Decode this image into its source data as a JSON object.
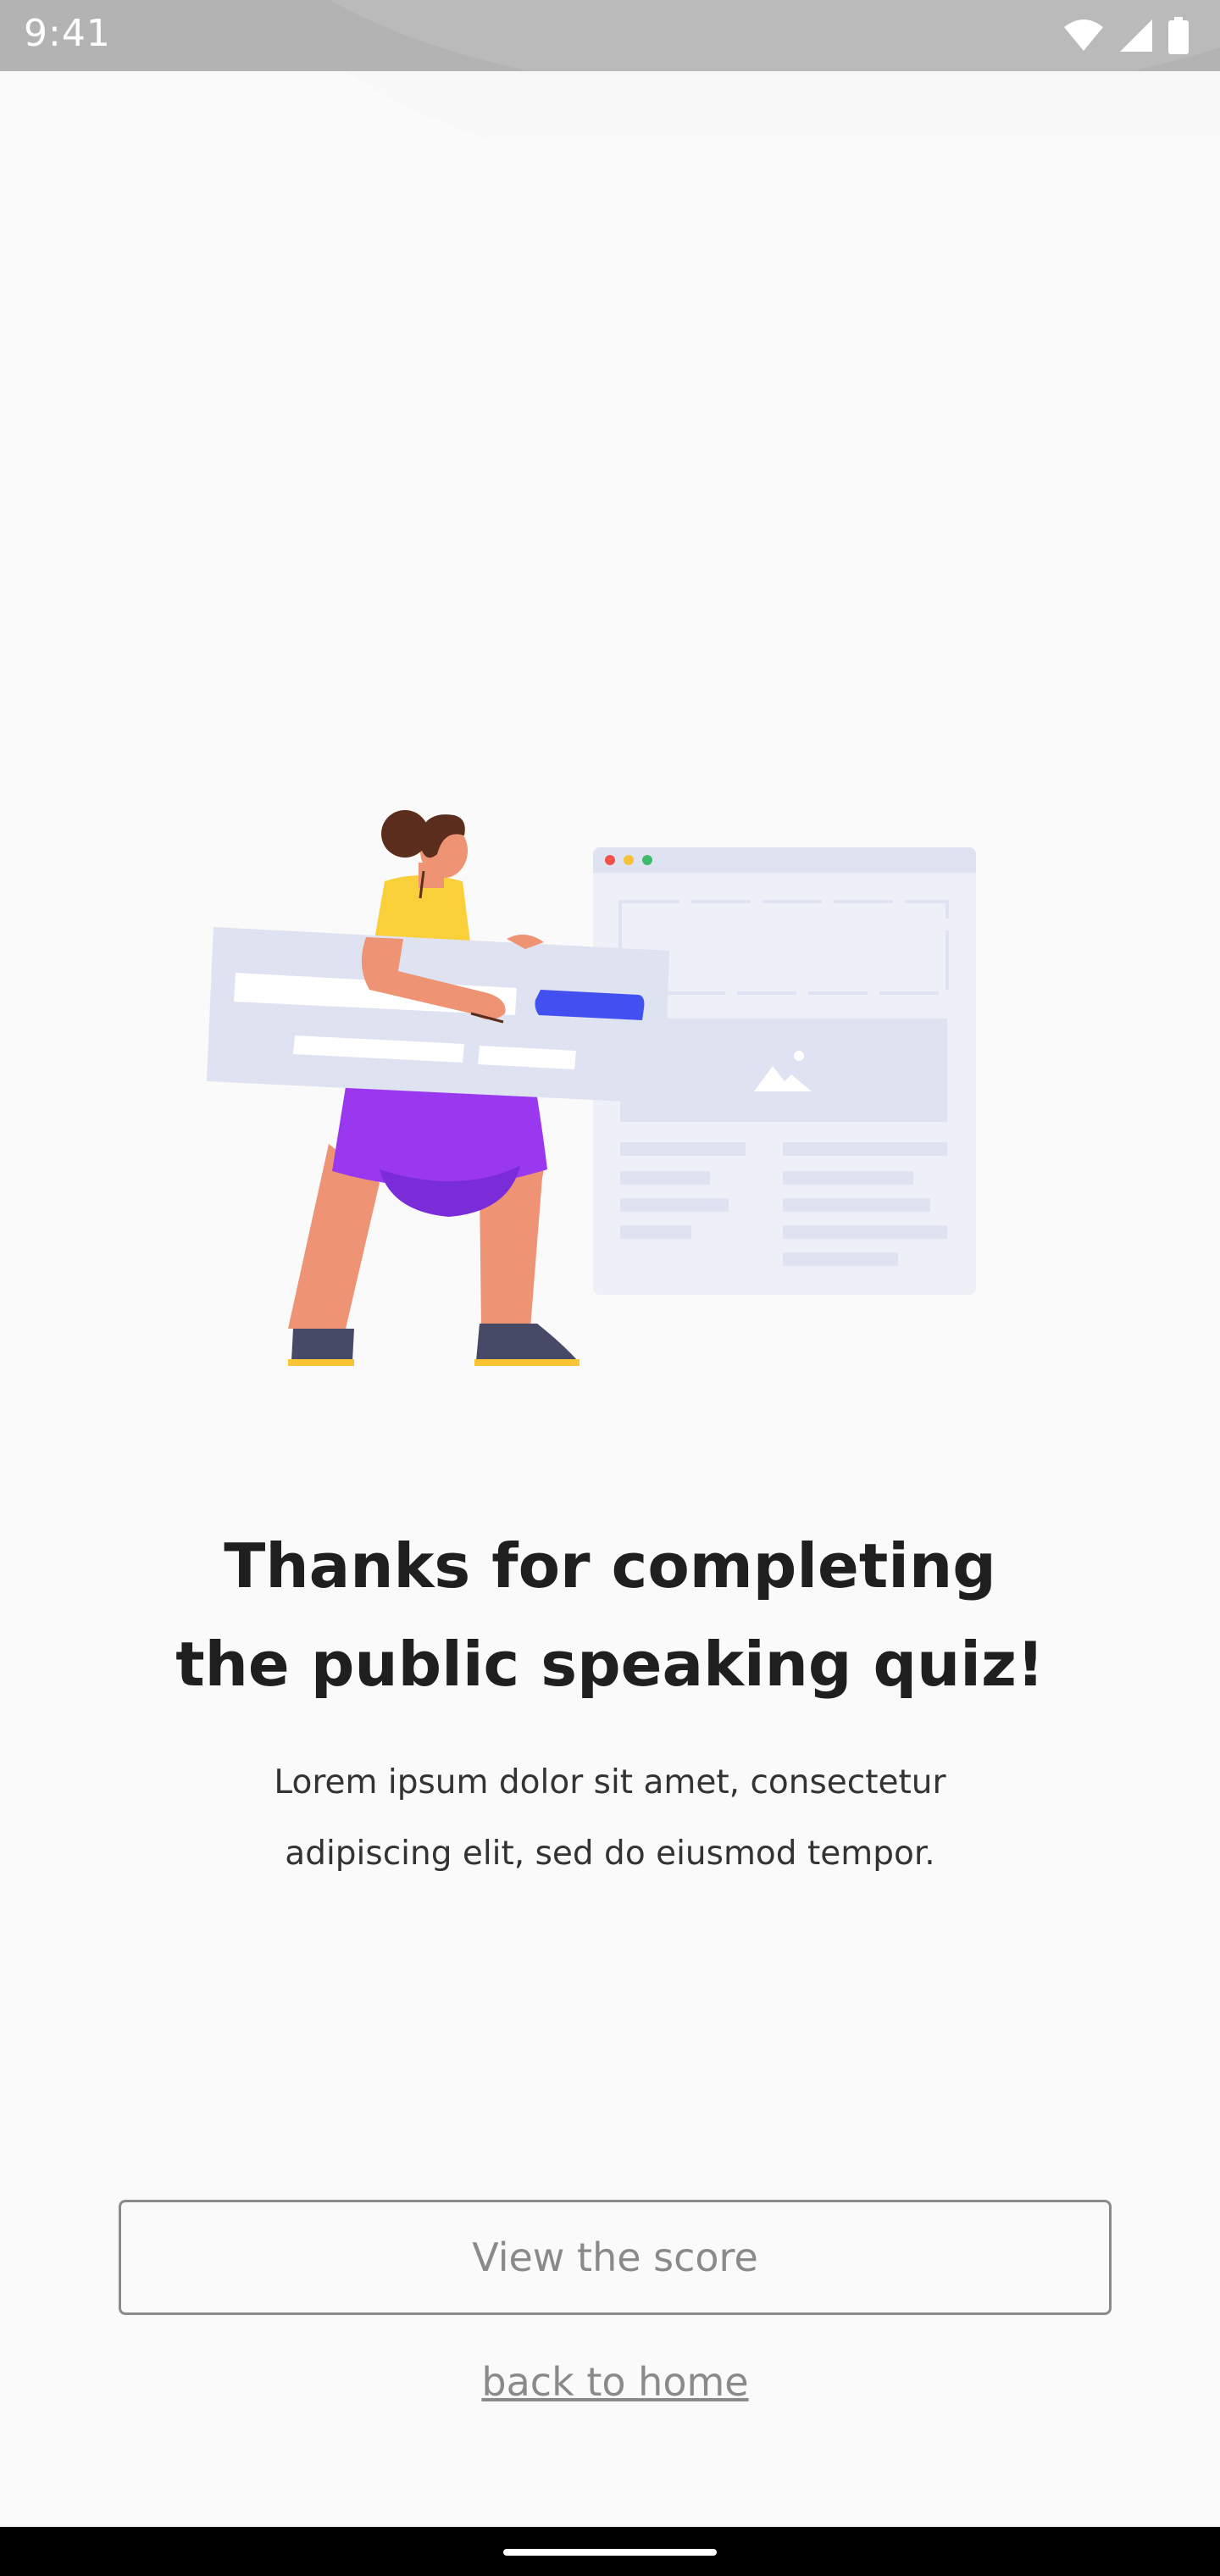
{
  "status_bar": {
    "time": "9:41",
    "icons": [
      "wifi-icon",
      "cellular-signal-icon",
      "battery-icon"
    ]
  },
  "main": {
    "title_line1": "Thanks for completing",
    "title_line2": "the public speaking quiz!",
    "subtitle_line1": "Lorem ipsum dolor sit amet, consectetur",
    "subtitle_line2": "adipiscing elit, sed do eiusmod tempor."
  },
  "actions": {
    "view_score_label": "View the score",
    "back_home_label": "back to home"
  },
  "colors": {
    "title": "#1f1f1f",
    "button_border": "#8a8a8a",
    "button_text": "#8a8a8a",
    "illustration_accent": "#4250f0",
    "illustration_skirt": "#9a38f0",
    "illustration_shirt": "#f9cf3a"
  }
}
